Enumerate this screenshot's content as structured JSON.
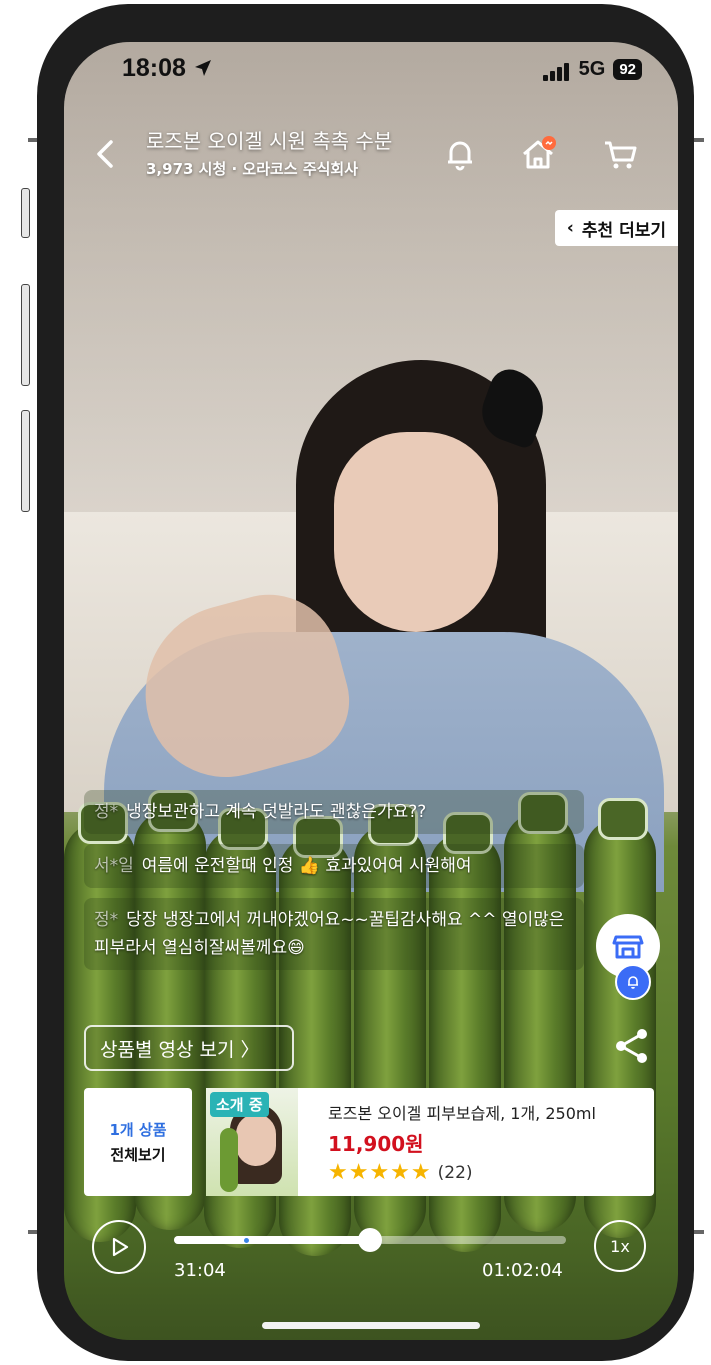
{
  "status_bar": {
    "time": "18:08",
    "network": "5G",
    "battery": "92"
  },
  "header": {
    "title": "로즈본 오이겔 시원 촉촉 수분",
    "subtitle": "3,973 시청 · 오라코스 주식회사"
  },
  "recommend_button": "추천 더보기",
  "chat": [
    {
      "user": "정*",
      "text": "냉장보관하고 계속 덧발라도 괜찮은가요??"
    },
    {
      "user": "서*일",
      "text": "여름에 운전할때 인정 👍  효과있어여 시원해여"
    },
    {
      "user": "정*",
      "text": "당장 냉장고에서 꺼내야겠어요~~꿀팁감사해요 ^^ 열이많은피부라서 열심히잘써볼께요😄"
    }
  ],
  "videos_by_product_button": "상품별 영상 보기  〉",
  "products_button": {
    "line1": "1개 상품",
    "line2": "전체보기"
  },
  "product": {
    "tag": "소개 중",
    "name": "로즈본 오이겔 피부보습제, 1개, 250ml",
    "price": "11,900원",
    "stars_display": "★★★★★",
    "rating": 4.5,
    "reviews": "(22)"
  },
  "player": {
    "current_time": "31:04",
    "total_time": "01:02:04",
    "speed": "1x",
    "progress": 0.5
  },
  "colors": {
    "accent_blue": "#3b6cf6",
    "price_red": "#d2101e",
    "live_tag": "#2ab3b5",
    "star": "#f6b400"
  }
}
